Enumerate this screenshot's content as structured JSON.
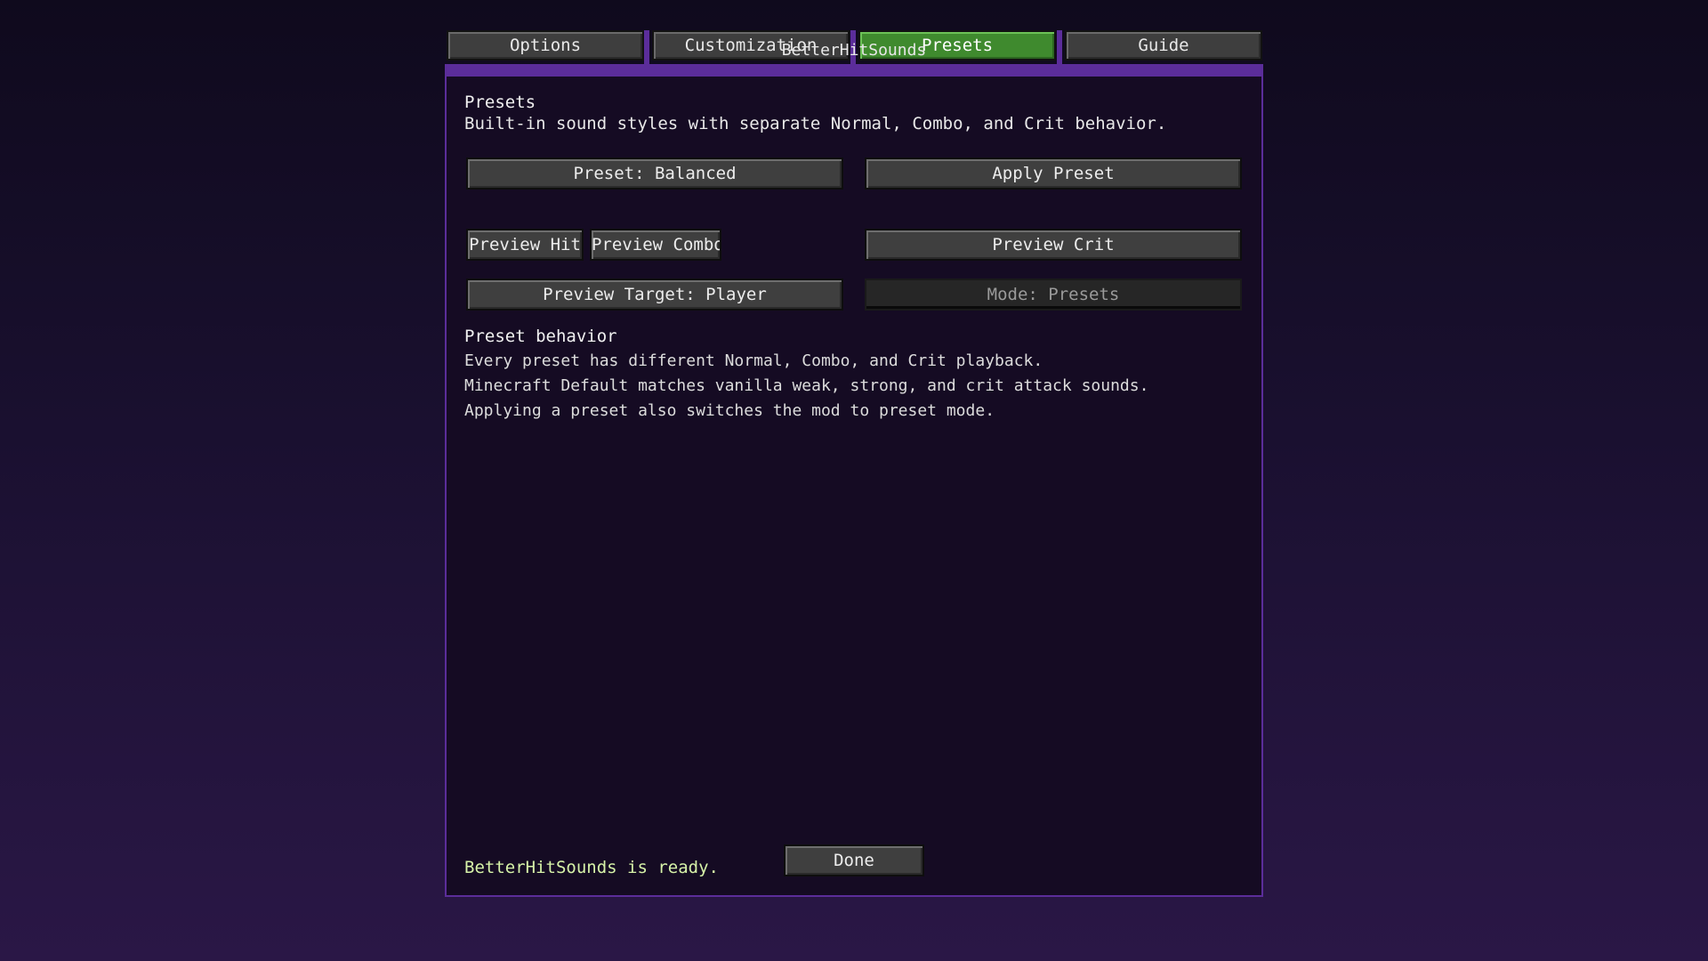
{
  "app": {
    "title": "BetterHitSounds"
  },
  "tabs": [
    {
      "label": "Options",
      "active": false
    },
    {
      "label": "Customization",
      "active": false
    },
    {
      "label": "Presets",
      "active": true
    },
    {
      "label": "Guide",
      "active": false
    }
  ],
  "section": {
    "title": "Presets",
    "description": "Built-in sound styles with separate Normal, Combo, and Crit behavior."
  },
  "buttons": {
    "preset_select": "Preset: Balanced",
    "apply_preset": "Apply Preset",
    "preview_hit": "Preview Hit",
    "preview_combo": "Preview Combo",
    "preview_crit": "Preview Crit",
    "preview_target": "Preview Target: Player",
    "mode": "Mode: Presets",
    "done": "Done"
  },
  "behavior": {
    "heading": "Preset behavior",
    "lines": [
      "Every preset has different Normal, Combo, and Crit playback.",
      "Minecraft Default matches vanilla weak, strong, and crit attack sounds.",
      "Applying a preset also switches the mod to preset mode."
    ]
  },
  "status": "BetterHitSounds is ready.",
  "colors": {
    "accent": "#5b2d9a",
    "active_tab": "#3f8a2e",
    "status_text": "#d6f2a8",
    "panel_background": "#150b23"
  }
}
